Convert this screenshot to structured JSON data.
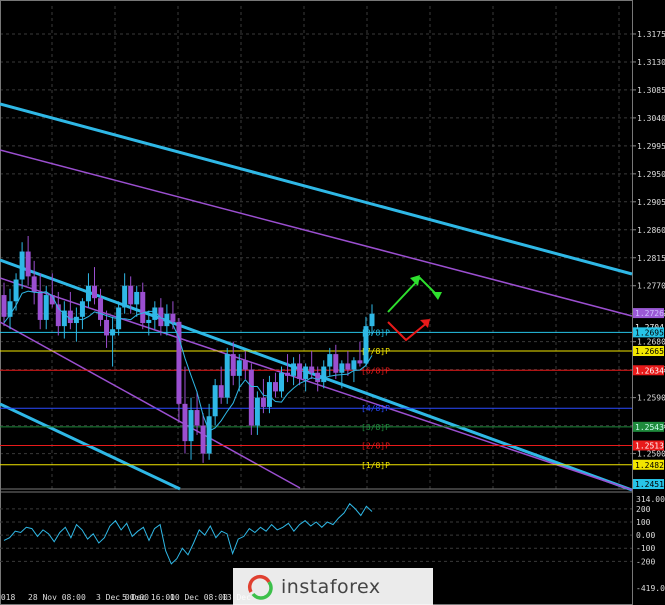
{
  "chart_data": [
    {
      "type": "candlestick",
      "y_ticks": [
        "1.3175",
        "1.3130",
        "1.3085",
        "1.3040",
        "1.2995",
        "1.2950",
        "1.2905",
        "1.2860",
        "1.2815",
        "1.2770",
        "1.2725",
        "1.2680",
        "1.2635",
        "1.2590",
        "1.2545",
        "1.2500"
      ],
      "ylim": [
        1.2443,
        1.322
      ],
      "x_ticks": [
        "2018",
        "28 Nov 08:00",
        "3 Dec 00:00",
        "5 Dec 16:00",
        "10 Dec 08:00",
        "13 Dec"
      ],
      "grid": true,
      "price_badges": [
        {
          "label": "1.2726",
          "value": 1.2726,
          "color": "#9b59d6",
          "text_color": "#d0c0ff"
        },
        {
          "label": "1.2704",
          "value": 1.2704,
          "color": "#000000",
          "text_color": "#ffffff"
        },
        {
          "label": "1.2695",
          "value": 1.2695,
          "color": "#27c4e8",
          "text_color": "#000000"
        },
        {
          "label": "1.2665",
          "value": 1.2665,
          "color": "#f2e600",
          "text_color": "#000000"
        },
        {
          "label": "1.2634",
          "value": 1.2634,
          "color": "#e81a1a",
          "text_color": "#ffffff"
        },
        {
          "label": "1.2543",
          "value": 1.2543,
          "color": "#1e8a3c",
          "text_color": "#cfe"
        },
        {
          "label": "1.2513",
          "value": 1.2513,
          "color": "#e81a1a",
          "text_color": "#ffffff"
        },
        {
          "label": "1.2482",
          "value": 1.2482,
          "color": "#f2e600",
          "text_color": "#000000"
        },
        {
          "label": "1.2451",
          "value": 1.2451,
          "color": "#27c4e8",
          "text_color": "#000000"
        }
      ],
      "murrey_levels": [
        {
          "label": "[8/8]P",
          "value": 1.2695,
          "color": "#27c4e8"
        },
        {
          "label": "[7/8]P",
          "value": 1.2665,
          "color": "#f2e600"
        },
        {
          "label": "[6/8]P",
          "value": 1.2634,
          "color": "#e81a1a"
        },
        {
          "label": "[4/8]P",
          "value": 1.2573,
          "color": "#2a4bff"
        },
        {
          "label": "[3/8]P",
          "value": 1.2543,
          "color": "#1e8a3c"
        },
        {
          "label": "[2/8]P",
          "value": 1.2513,
          "color": "#e81a1a"
        },
        {
          "label": "[1/8]P",
          "value": 1.2482,
          "color": "#f2e600"
        }
      ],
      "candles": [
        [
          1.2755,
          1.2775,
          1.2705,
          1.272
        ],
        [
          1.272,
          1.2765,
          1.27,
          1.2745
        ],
        [
          1.2745,
          1.279,
          1.273,
          1.278
        ],
        [
          1.278,
          1.284,
          1.2765,
          1.2825
        ],
        [
          1.2825,
          1.285,
          1.277,
          1.2785
        ],
        [
          1.2785,
          1.281,
          1.274,
          1.276
        ],
        [
          1.276,
          1.279,
          1.27,
          1.2715
        ],
        [
          1.2715,
          1.277,
          1.27,
          1.2755
        ],
        [
          1.2755,
          1.279,
          1.2735,
          1.274
        ],
        [
          1.274,
          1.276,
          1.269,
          1.2705
        ],
        [
          1.2705,
          1.2745,
          1.2685,
          1.273
        ],
        [
          1.273,
          1.276,
          1.27,
          1.271
        ],
        [
          1.271,
          1.2735,
          1.268,
          1.272
        ],
        [
          1.272,
          1.275,
          1.27,
          1.2745
        ],
        [
          1.2745,
          1.279,
          1.2735,
          1.277
        ],
        [
          1.277,
          1.28,
          1.274,
          1.275
        ],
        [
          1.275,
          1.2765,
          1.2705,
          1.2715
        ],
        [
          1.2715,
          1.273,
          1.267,
          1.269
        ],
        [
          1.269,
          1.272,
          1.264,
          1.27
        ],
        [
          1.27,
          1.2745,
          1.269,
          1.2735
        ],
        [
          1.2735,
          1.279,
          1.2725,
          1.277
        ],
        [
          1.277,
          1.2785,
          1.2725,
          1.274
        ],
        [
          1.274,
          1.277,
          1.272,
          1.276
        ],
        [
          1.276,
          1.2775,
          1.27,
          1.271
        ],
        [
          1.271,
          1.273,
          1.269,
          1.2715
        ],
        [
          1.2715,
          1.2745,
          1.27,
          1.2735
        ],
        [
          1.2735,
          1.275,
          1.269,
          1.2705
        ],
        [
          1.2705,
          1.274,
          1.269,
          1.2725
        ],
        [
          1.2725,
          1.2745,
          1.27,
          1.2712
        ],
        [
          1.2712,
          1.2718,
          1.255,
          1.258
        ],
        [
          1.258,
          1.264,
          1.25,
          1.252
        ],
        [
          1.252,
          1.259,
          1.249,
          1.257
        ],
        [
          1.257,
          1.26,
          1.253,
          1.2545
        ],
        [
          1.2545,
          1.2565,
          1.2485,
          1.25
        ],
        [
          1.25,
          1.258,
          1.249,
          1.256
        ],
        [
          1.256,
          1.262,
          1.2545,
          1.261
        ],
        [
          1.261,
          1.264,
          1.258,
          1.259
        ],
        [
          1.259,
          1.267,
          1.258,
          1.266
        ],
        [
          1.266,
          1.268,
          1.261,
          1.2625
        ],
        [
          1.2625,
          1.266,
          1.26,
          1.265
        ],
        [
          1.265,
          1.2665,
          1.262,
          1.2635
        ],
        [
          1.2635,
          1.2645,
          1.253,
          1.2545
        ],
        [
          1.2545,
          1.26,
          1.253,
          1.259
        ],
        [
          1.259,
          1.262,
          1.2565,
          1.2575
        ],
        [
          1.2575,
          1.2625,
          1.2565,
          1.2615
        ],
        [
          1.2615,
          1.263,
          1.259,
          1.26
        ],
        [
          1.26,
          1.264,
          1.259,
          1.263
        ],
        [
          1.263,
          1.266,
          1.2615,
          1.2625
        ],
        [
          1.2625,
          1.2655,
          1.261,
          1.2645
        ],
        [
          1.2645,
          1.266,
          1.261,
          1.262
        ],
        [
          1.262,
          1.2645,
          1.26,
          1.264
        ],
        [
          1.264,
          1.2665,
          1.262,
          1.263
        ],
        [
          1.263,
          1.264,
          1.26,
          1.2615
        ],
        [
          1.2615,
          1.265,
          1.2605,
          1.264
        ],
        [
          1.264,
          1.267,
          1.2625,
          1.266
        ],
        [
          1.266,
          1.2675,
          1.262,
          1.263
        ],
        [
          1.263,
          1.265,
          1.2605,
          1.2645
        ],
        [
          1.2645,
          1.2665,
          1.2625,
          1.2635
        ],
        [
          1.2635,
          1.2655,
          1.2615,
          1.265
        ],
        [
          1.265,
          1.268,
          1.264,
          1.2645
        ],
        [
          1.2645,
          1.272,
          1.264,
          1.2705
        ],
        [
          1.2705,
          1.274,
          1.269,
          1.2725
        ]
      ],
      "indicator": {
        "ylim": [
          -419.0,
          314.0
        ],
        "ticks": [
          "314.0099",
          "200",
          "100",
          "0.00",
          "-100",
          "-200",
          "-419.0766"
        ]
      }
    }
  ],
  "watermark": {
    "text": "instaforex"
  }
}
